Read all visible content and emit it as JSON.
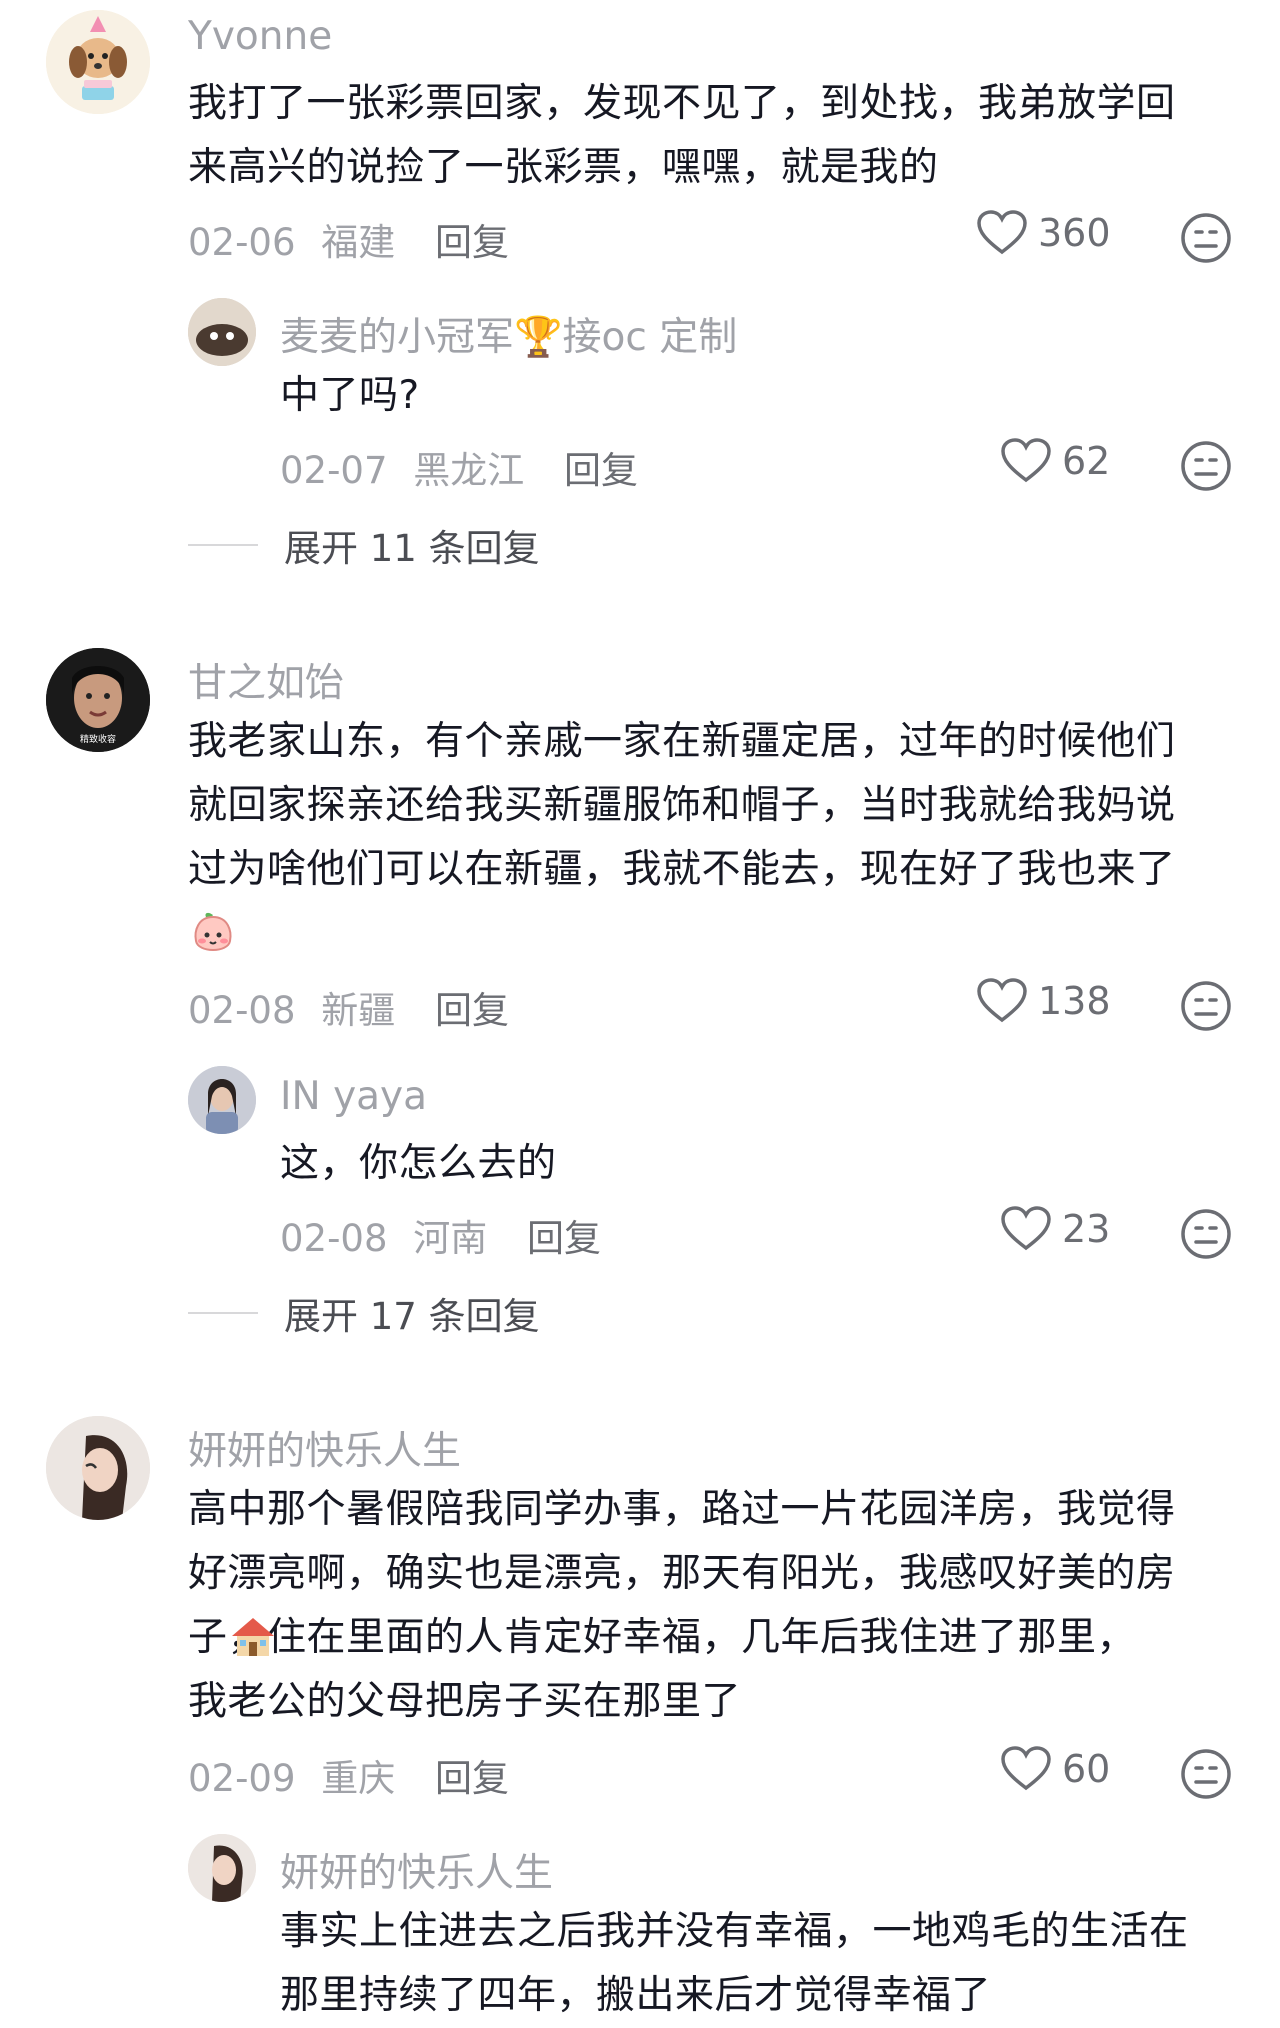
{
  "comments": [
    {
      "author": "Yvonne",
      "text_lines": [
        "我打了一张彩票回家，发现不见了，到处找，我弟放学回",
        "来高兴的说捡了一张彩票，嘿嘿，就是我的"
      ],
      "date": "02-06",
      "location": "福建",
      "reply_label": "回复",
      "likes": "360",
      "replies": [
        {
          "author": "麦麦的小冠军🏆接oc 定制",
          "text": "中了吗?",
          "date": "02-07",
          "location": "黑龙江",
          "reply_label": "回复",
          "likes": "62"
        }
      ],
      "expand_label": "展开 11 条回复"
    },
    {
      "author": "甘之如饴",
      "text_lines": [
        "我老家山东，有个亲戚一家在新疆定居，过年的时候他们",
        "就回家探亲还给我买新疆服饰和帽子，当时我就给我妈说",
        "过为啥他们可以在新疆，我就不能去，现在好了我也来了"
      ],
      "date": "02-08",
      "location": "新疆",
      "reply_label": "回复",
      "likes": "138",
      "avatar_caption": "精致收容",
      "replies": [
        {
          "author": "IN yaya",
          "text": "这，你怎么去的",
          "date": "02-08",
          "location": "河南",
          "reply_label": "回复",
          "likes": "23"
        }
      ],
      "expand_label": "展开 17 条回复"
    },
    {
      "author": "妍妍的快乐人生",
      "text_lines": [
        "高中那个暑假陪我同学办事，路过一片花园洋房，我觉得",
        "好漂亮啊，确实也是漂亮，那天有阳光，我感叹好美的房",
        "子，住在里面的人肯定好幸福，几年后我住进了那里，",
        "我老公的父母把房子买在那里了"
      ],
      "date": "02-09",
      "location": "重庆",
      "reply_label": "回复",
      "likes": "60",
      "replies": [
        {
          "author": "妍妍的快乐人生",
          "text_lines": [
            "事实上住进去之后我并没有幸福，一地鸡毛的生活在",
            "那里持续了四年，搬出来后才觉得幸福了"
          ]
        }
      ]
    }
  ],
  "icons": {
    "like": "heart-outline-icon",
    "emoji": "sticker-face-icon",
    "trophy": "trophy-icon",
    "house": "house-icon",
    "peach": "peach-face-icon"
  },
  "colors": {
    "name": "#a0a2a8",
    "text": "#161823",
    "meta": "#a0a2a8",
    "reply": "#6b6d73"
  }
}
